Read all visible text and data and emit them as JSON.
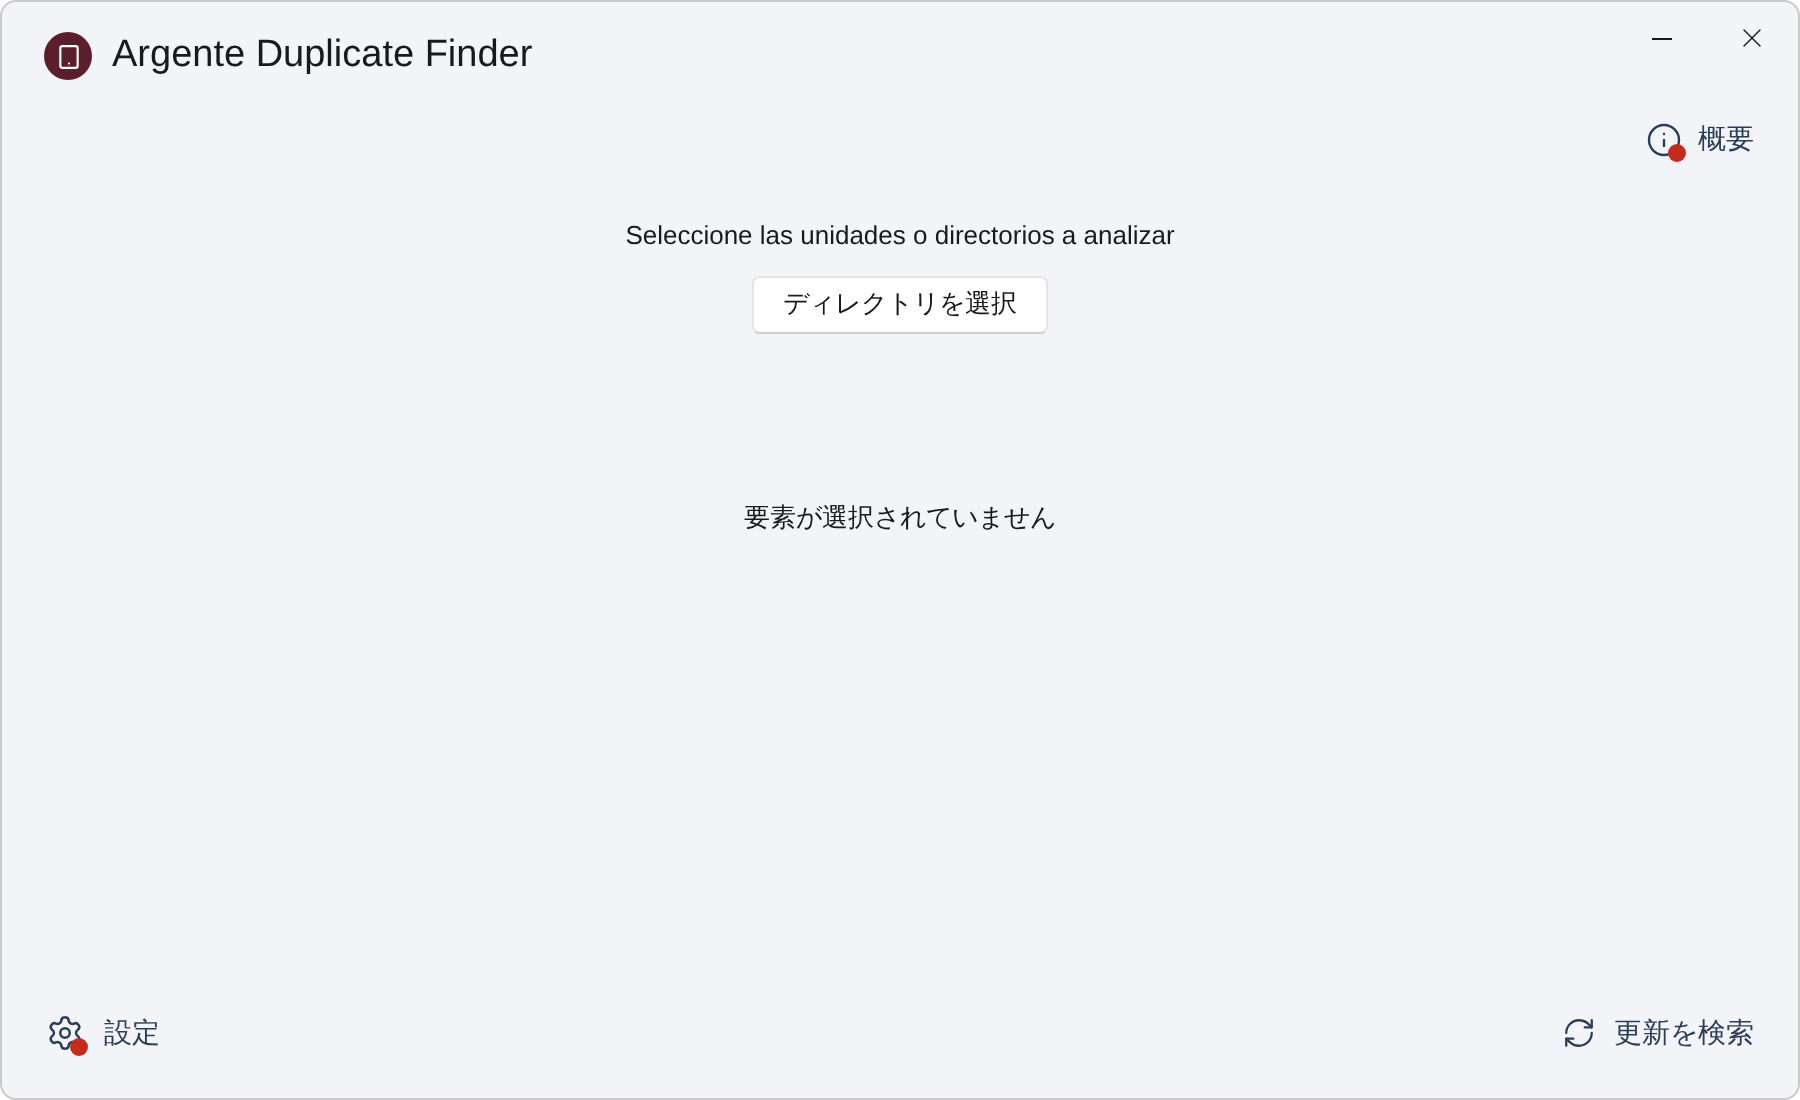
{
  "window": {
    "title": "Argente Duplicate Finder"
  },
  "about_link": {
    "label": "概要",
    "badge": true
  },
  "prompt": "Seleccione las unidades o directorios a analizar",
  "select_button": "ディレクトリを選択",
  "empty_message": "要素が選択されていません",
  "settings_link": {
    "label": "設定",
    "badge": true
  },
  "update_link": {
    "label": "更新を検索"
  }
}
